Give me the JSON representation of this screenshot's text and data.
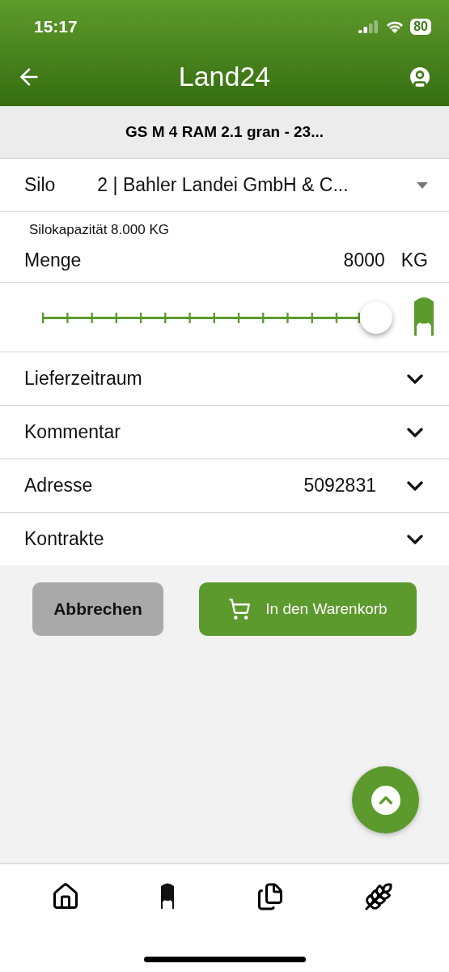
{
  "status_bar": {
    "time": "15:17",
    "battery": "80"
  },
  "header": {
    "title": "Land24"
  },
  "product": {
    "title": "GS M 4 RAM 2.1 gran - 23..."
  },
  "silo": {
    "label": "Silo",
    "value": "2 | Bahler Landei GmbH & C...",
    "capacity": "Silokapazität 8.000 KG"
  },
  "quantity": {
    "label": "Menge",
    "value": "8000",
    "unit": "KG",
    "level": 1
  },
  "sections": [
    {
      "label": "Lieferzeitraum",
      "expanded": false
    },
    {
      "label": "Kommentar",
      "expanded": false
    },
    {
      "label": "Adresse",
      "value": "5092831",
      "expanded": false
    },
    {
      "label": "Kontrakte",
      "expanded": false
    }
  ],
  "buttons": {
    "cancel": "Abbrechen",
    "cart": "In den Warenkorb"
  }
}
